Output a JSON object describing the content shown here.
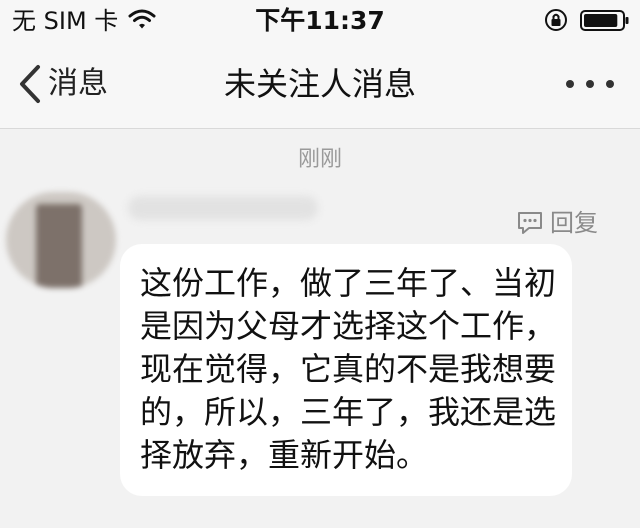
{
  "status_bar": {
    "carrier": "无 SIM 卡",
    "time": "下午11:37",
    "wifi_icon": "wifi-icon",
    "lock_icon": "orientation-lock-icon",
    "battery_icon": "battery-icon",
    "battery_level": 0.9
  },
  "nav": {
    "back_label": "消息",
    "title": "未关注人消息",
    "back_icon": "chevron-left-icon",
    "more_icon": "more-dots-icon"
  },
  "conversation": {
    "timestamp": "刚刚",
    "reply_label": "回复",
    "reply_icon": "comment-icon",
    "message": "这份工作，做了三年了、当初是因为父母才选择这个工作，现在觉得，它真的不是我想要的，所以，三年了，我还是选择放弃，重新开始。"
  },
  "colors": {
    "background": "#f2f2f2",
    "bar": "#f7f7f7",
    "bubble": "#ffffff",
    "muted_text": "#9a9a9a"
  }
}
